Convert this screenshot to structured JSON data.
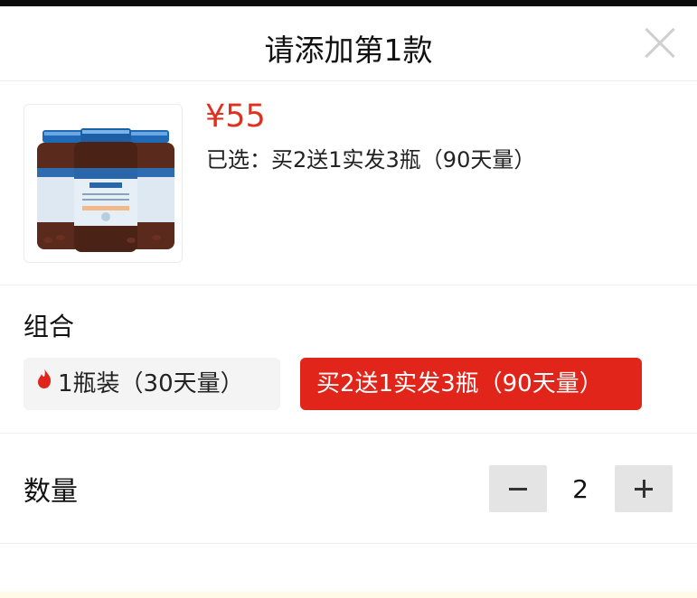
{
  "sheet": {
    "title": "请添加第1款",
    "close_icon": "close-icon"
  },
  "product": {
    "image_icon": "product-bottles-image",
    "price": "¥55",
    "selected_text": "已选：买2送1实发3瓶（90天量）"
  },
  "combo": {
    "label": "组合",
    "options": [
      {
        "label": "1瓶装（30天量）",
        "icon": "flame-icon",
        "selected": false
      },
      {
        "label": "买2送1实发3瓶（90天量）",
        "selected": true
      }
    ]
  },
  "quantity": {
    "label": "数量",
    "value": "2",
    "minus_icon": "minus-icon",
    "plus_icon": "plus-icon"
  },
  "colors": {
    "accent": "#e1251b",
    "price": "#e0301e",
    "option_bg": "#f4f4f4",
    "stepper_bg": "#e4e4e4"
  }
}
